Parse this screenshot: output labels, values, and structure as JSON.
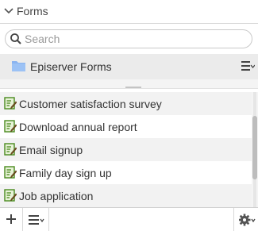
{
  "header": {
    "title": "Forms"
  },
  "search": {
    "placeholder": "Search",
    "value": ""
  },
  "root_folder": {
    "label": "Episerver Forms"
  },
  "forms": [
    {
      "label": "Customer satisfaction survey"
    },
    {
      "label": "Download annual report"
    },
    {
      "label": "Email signup"
    },
    {
      "label": "Family day sign up"
    },
    {
      "label": "Job application"
    }
  ],
  "icons": {
    "collapse": "chevron-down-icon",
    "search": "search-icon",
    "folder": "folder-icon",
    "folder_menu": "context-menu-icon",
    "form": "form-edit-icon",
    "add": "plus-icon",
    "list_menu": "list-menu-icon",
    "settings": "gear-icon"
  },
  "colors": {
    "folder": "#8ab4f0",
    "form_icon_green": "#4a8a1e",
    "selected_row": "#ebebeb"
  }
}
